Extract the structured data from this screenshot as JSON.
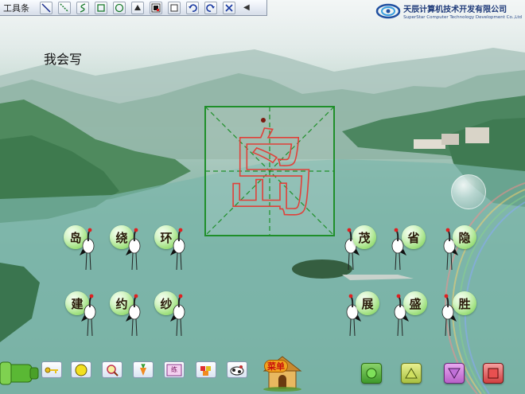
{
  "toolbar": {
    "title": "工具条",
    "tools": [
      {
        "name": "line-tool",
        "icon": "line-icon"
      },
      {
        "name": "dotted-line-tool",
        "icon": "dotted-line-icon"
      },
      {
        "name": "curve-tool",
        "icon": "curve-icon"
      },
      {
        "name": "rectangle-tool",
        "icon": "rectangle-icon"
      },
      {
        "name": "ellipse-tool",
        "icon": "ellipse-icon"
      },
      {
        "name": "fill-tool",
        "icon": "fill-icon"
      },
      {
        "name": "color-tool",
        "icon": "color-swatch-icon"
      },
      {
        "name": "eraser-tool",
        "icon": "eraser-icon"
      },
      {
        "name": "undo-tool",
        "icon": "undo-icon"
      },
      {
        "name": "redo-tool",
        "icon": "redo-icon"
      },
      {
        "name": "clear-tool",
        "icon": "clear-icon"
      }
    ],
    "collapse_symbol": "◀"
  },
  "company": {
    "name_cn": "天辰计算机技术开发有限公司",
    "name_en": "SuperStar Computer Technology Development Co.,Ltd"
  },
  "lesson": {
    "title": "我会写",
    "featured_character": "岛"
  },
  "characters_left": [
    "岛",
    "绕",
    "环",
    "建",
    "约",
    "纱"
  ],
  "characters_right": [
    "茂",
    "省",
    "隐",
    "展",
    "盛",
    "胜"
  ],
  "bottom_bar": {
    "menu_label": "菜单",
    "buttons": [
      "key-icon",
      "circle-icon",
      "magnifier-icon",
      "carrot-icon",
      "practice-icon",
      "puzzle-icon",
      "cow-icon"
    ],
    "practice_label": "练"
  },
  "nav": [
    "green-circle-button",
    "up-triangle-button",
    "down-triangle-button",
    "stop-square-button"
  ],
  "colors": {
    "grid_green": "#1f8f2a",
    "stroke_red": "#e0413a",
    "bubble_green": "#9fe07e",
    "menu_orange": "#f0a31e"
  }
}
